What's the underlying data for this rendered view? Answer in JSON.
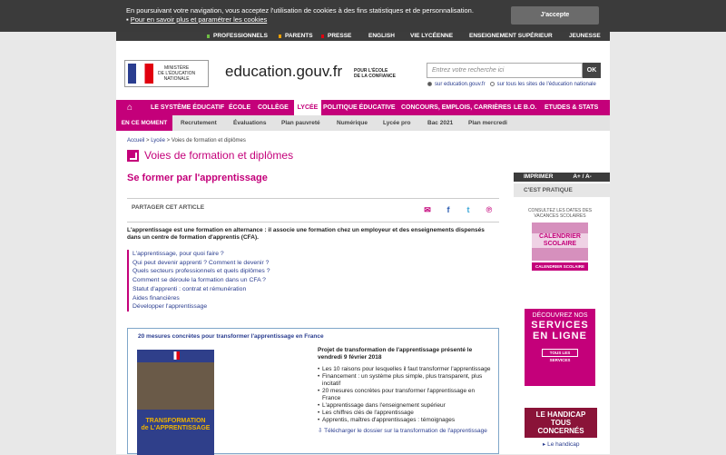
{
  "cookie": {
    "line1": "En poursuivant votre navigation, vous acceptez l'utilisation de cookies à des fins statistiques et de personnalisation.",
    "link": "Pour en savoir plus et paramétrer les cookies",
    "accept": "J'accepte"
  },
  "topnav": [
    "PROFESSIONNELS",
    "PARENTS",
    "PRESSE",
    "ENGLISH",
    "VIE LYCÉENNE",
    "ENSEIGNEMENT SUPÉRIEUR",
    "JEUNESSE"
  ],
  "header": {
    "ministry": "MINISTÈRE\nDE L'ÉDUCATION\nNATIONALE",
    "site": "education.gouv.fr",
    "slogan1": "POUR L'ÉCOLE",
    "slogan2": "DE LA CONFIANCE",
    "search_placeholder": "Entrez votre recherche ici",
    "search_ok": "OK",
    "radio1": "sur education.gouv.fr",
    "radio2": "sur tous les sites de l'éducation nationale"
  },
  "mainnav": [
    "LE SYSTÈME ÉDUCATIF",
    "ÉCOLE",
    "COLLÈGE",
    "LYCÉE",
    "POLITIQUE ÉDUCATIVE",
    "CONCOURS, EMPLOIS, CARRIÈRES",
    "LE B.O.",
    "ETUDES & STATS"
  ],
  "subnav": {
    "label": "EN CE MOMENT",
    "items": [
      "Recrutement",
      "Évaluations",
      "Plan pauvreté",
      "Numérique",
      "Lycée pro",
      "Bac 2021",
      "Plan mercredi"
    ]
  },
  "breadcrumb": [
    "Accueil",
    "Lycée",
    "Voies de formation et diplômes"
  ],
  "section_title": "Voies de formation et diplômes",
  "title": "Se former par l'apprentissage",
  "share_label": "PARTAGER CET ARTICLE",
  "intro": "L'apprentissage est une formation en alternance : il associe une formation chez un employeur et des enseignements dispensés dans un centre de formation d'apprentis (CFA).",
  "toc": [
    "L'apprentissage, pour quoi faire ?",
    "Qui peut devenir apprenti ? Comment le devenir ?",
    "Quels secteurs professionnels et quels diplômes ?",
    "Comment se déroule la formation dans un CFA ?",
    "Statut d'apprenti : contrat et rémunération",
    "Aides financières",
    "Développer l'apprentissage"
  ],
  "box": {
    "title": "20 mesures concrètes pour transformer l'apprentissage en France",
    "cover_title": "TRANSFORMATION\nde L'APPRENTISSAGE",
    "heading": "Projet de transformation de l'apprentissage présenté le vendredi 9 février 2018",
    "items": [
      "Les 10 raisons pour lesquelles il faut transformer l'apprentissage",
      "Financement : un système plus simple, plus transparent, plus incitatif",
      "20 mesures concrètes pour transformer l'apprentissage en France",
      "L'apprentissage dans l'enseignement supérieur",
      "Les chiffres clés de l'apprentissage",
      "Apprentis, maîtres d'apprentissages : témoignages"
    ],
    "download": "Télécharger le dossier sur la transformation de l'apprentissage"
  },
  "sidebar": {
    "print": "IMPRIMER",
    "fontsize": "A+ / A-",
    "head": "C'EST PRATIQUE",
    "promo1_text": "CONSULTEZ LES DATES DES VACANCES SCOLAIRES",
    "promo1_title": "CALENDRIER SCOLAIRE",
    "promo1_bar": "CALENDRIER SCOLAIRE",
    "promo2_l1": "DÉCOUVREZ NOS",
    "promo2_l2": "SERVICES",
    "promo2_l3": "EN LIGNE",
    "promo2_btn": "TOUS LES SERVICES",
    "promo3_title": "LE HANDICAP TOUS CONCERNÉS",
    "promo3_link": "Le handicap"
  }
}
